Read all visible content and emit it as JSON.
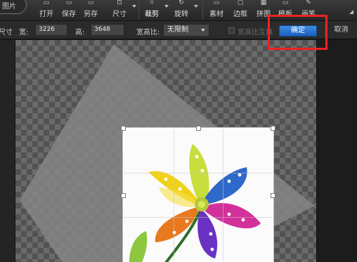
{
  "app": {
    "menu_label": "图片"
  },
  "toolbar": {
    "items": [
      {
        "label": "打开",
        "icon": "open-icon"
      },
      {
        "label": "保存",
        "icon": "save-icon"
      },
      {
        "label": "另存",
        "icon": "save-as-icon"
      },
      {
        "label": "尺寸",
        "icon": "resize-icon"
      },
      {
        "label": "裁剪",
        "icon": "crop-icon",
        "active": true
      },
      {
        "label": "旋转",
        "icon": "rotate-icon"
      },
      {
        "label": "素材",
        "icon": "material-icon"
      },
      {
        "label": "边框",
        "icon": "border-icon"
      },
      {
        "label": "拼图",
        "icon": "collage-icon"
      },
      {
        "label": "模板",
        "icon": "template-icon"
      },
      {
        "label": "画笔",
        "icon": "brush-icon"
      }
    ]
  },
  "options": {
    "size_label": "尺寸",
    "width_label": "宽:",
    "width_value": "3226",
    "height_label": "高:",
    "height_value": "3648",
    "ratio_label": "宽高比:",
    "ratio_value": "无限制",
    "lock_label": "宽高比互换",
    "confirm_label": "确定",
    "cancel_label": "取消"
  },
  "colors": {
    "confirm_blue": "#2a74d4",
    "highlight_red": "#ee2222",
    "canvas_bg": "#181818"
  }
}
